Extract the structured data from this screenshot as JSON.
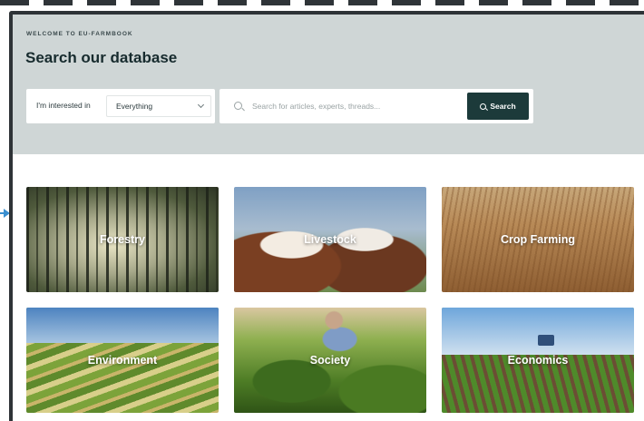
{
  "hero": {
    "eyebrow": "WELCOME TO EU-FARMBOOK",
    "title": "Search our database"
  },
  "filter": {
    "label": "I'm interested in",
    "selected": "Everything"
  },
  "search": {
    "placeholder": "Search for articles, experts, threads...",
    "button_label": "Search"
  },
  "categories": [
    {
      "label": "Forestry"
    },
    {
      "label": "Livestock"
    },
    {
      "label": "Crop Farming"
    },
    {
      "label": "Environment"
    },
    {
      "label": "Society"
    },
    {
      "label": "Economics"
    }
  ],
  "colors": {
    "hero_bg": "#cfd6d6",
    "button_bg": "#1c3a3a",
    "title": "#172b2e",
    "pointer": "#3a8fd0"
  }
}
